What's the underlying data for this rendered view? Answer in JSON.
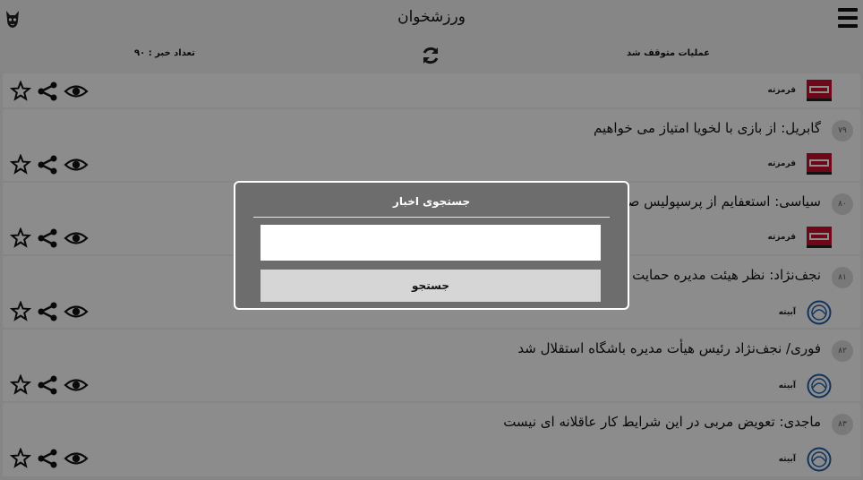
{
  "app": {
    "title": "ورزشخوان"
  },
  "status": {
    "count_label": "تعداد خبر : ۹۰",
    "operations_label": "عملیات متوقف شد"
  },
  "items": [
    {
      "number": "",
      "headline": "",
      "source": "قرمزته"
    },
    {
      "number": "۷۹",
      "headline": "گابریل: از بازی با لخویا امتیاز می خواهیم",
      "source": "قرمزته"
    },
    {
      "number": "۸۰",
      "headline": "سیاسی: استعفایم از پرسپولیس صح",
      "source": "قرمزته"
    },
    {
      "number": "۸۱",
      "headline": "نجف‌نژاد: نظر هیئت مدیره حمایت",
      "source": "آبیته"
    },
    {
      "number": "۸۲",
      "headline": "فوری/ نجف‌نژاد رئیس هیأت مدیره باشگاه استقلال شد",
      "source": "آبیته"
    },
    {
      "number": "۸۳",
      "headline": "ماجدی: تعویض مربی در این شرایط کار عاقلانه ای نیست",
      "source": "آبیته"
    }
  ],
  "dialog": {
    "title": "جستجوی اخبار",
    "input_value": "",
    "button_label": "جستجو"
  },
  "colors": {
    "red_logo": "#c8102e",
    "blue_logo": "#1f5ea8",
    "overlay": "#6d6d6d"
  }
}
